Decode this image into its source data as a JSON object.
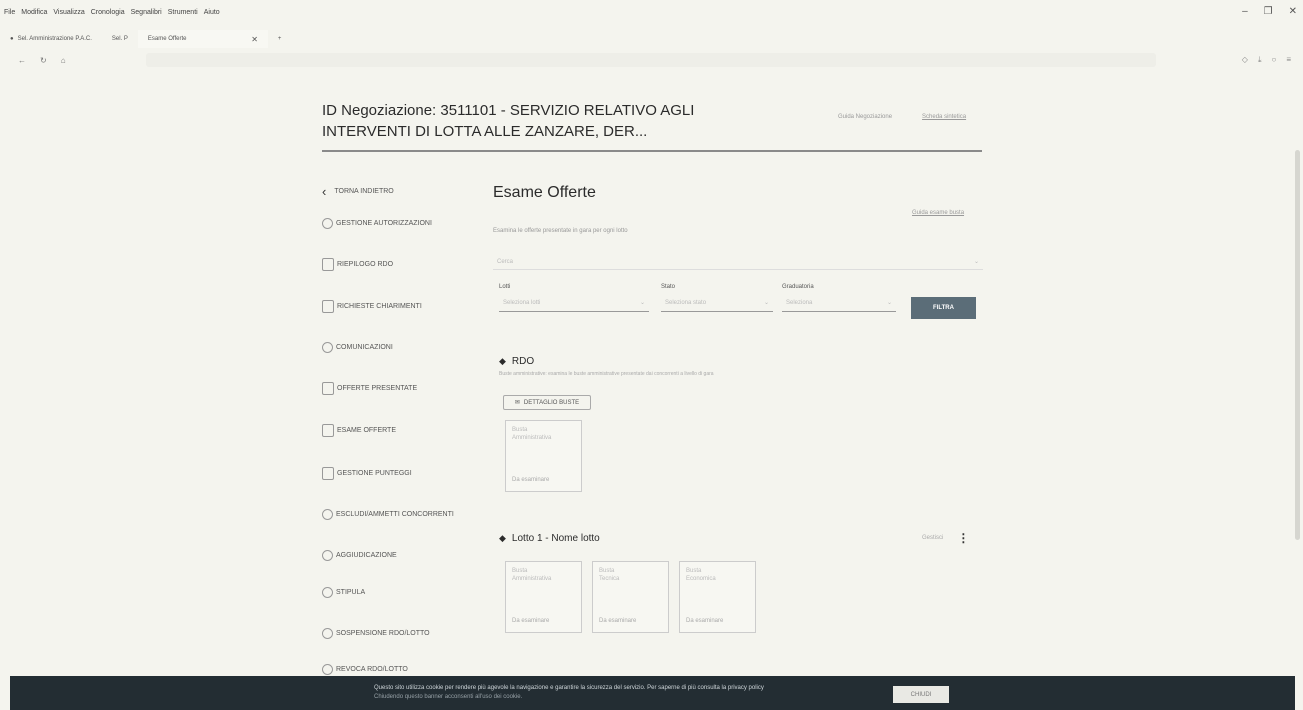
{
  "browser": {
    "menu": [
      "File",
      "Modifica",
      "Visualizza",
      "Cronologia",
      "Segnalibri",
      "Strumenti",
      "Aiuto"
    ],
    "tabs": [
      {
        "label": "Sel. Amministrazione P.A.C."
      },
      {
        "label": "Sel. P"
      },
      {
        "label": "Esame Offerte"
      }
    ]
  },
  "header": {
    "title": "ID Negoziazione: 3511101 - SERVIZIO RELATIVO AGLI INTERVENTI DI LOTTA ALLE ZANZARE, DER...",
    "links": [
      "Guida Negoziazione",
      "Scheda sintetica"
    ]
  },
  "sidebar": {
    "back_label": "TORNA INDIETRO",
    "items": [
      {
        "label": "GESTIONE AUTORIZZAZIONI"
      },
      {
        "label": "RIEPILOGO RDO"
      },
      {
        "label": "RICHIESTE CHIARIMENTI"
      },
      {
        "label": "COMUNICAZIONI"
      },
      {
        "label": "OFFERTE PRESENTATE"
      },
      {
        "label": "ESAME OFFERTE"
      },
      {
        "label": "GESTIONE PUNTEGGI"
      },
      {
        "label": "ESCLUDI/AMMETTI CONCORRENTI"
      },
      {
        "label": "AGGIUDICAZIONE"
      },
      {
        "label": "STIPULA"
      },
      {
        "label": "SOSPENSIONE RDO/LOTTO"
      },
      {
        "label": "REVOCA RDO/LOTTO"
      }
    ]
  },
  "main": {
    "title": "Esame Offerte",
    "subtitle": "Esamina le offerte presentate in gara per ogni lotto",
    "ext_link": "Guida esame busta",
    "search_placeholder": "Cerca",
    "filters": [
      {
        "label": "Lotti",
        "value": "Seleziona lotti"
      },
      {
        "label": "Stato",
        "value": "Seleziona stato"
      },
      {
        "label": "Graduatoria",
        "value": "Seleziona"
      }
    ],
    "filter_button": "FILTRA",
    "rdo": {
      "heading": "RDO",
      "description": "Buste amministrative: esamina le buste amministrative presentate dai concorrenti a livello di gara",
      "detail_button": "DETTAGLIO BUSTE",
      "cards": [
        {
          "name": "Busta",
          "value": "Amministrativa",
          "foot": "Da esaminare"
        }
      ]
    },
    "lotto": {
      "heading": "Lotto 1 - Nome lotto",
      "more_label": "Gestisci",
      "cards": [
        {
          "name": "Busta",
          "value": "Amministrativa",
          "foot": "Da esaminare"
        },
        {
          "name": "Busta",
          "value": "Tecnica",
          "foot": "Da esaminare"
        },
        {
          "name": "Busta",
          "value": "Economica",
          "foot": "Da esaminare"
        }
      ]
    }
  },
  "cookie_bar": {
    "text": "Questo sito utilizza cookie per rendere più agevole la navigazione e garantire la sicurezza del servizio. Per saperne di più consulta la privacy policy",
    "subtext": "Chiudendo questo banner acconsenti all'uso dei cookie.",
    "close_label": "CHIUDI"
  }
}
